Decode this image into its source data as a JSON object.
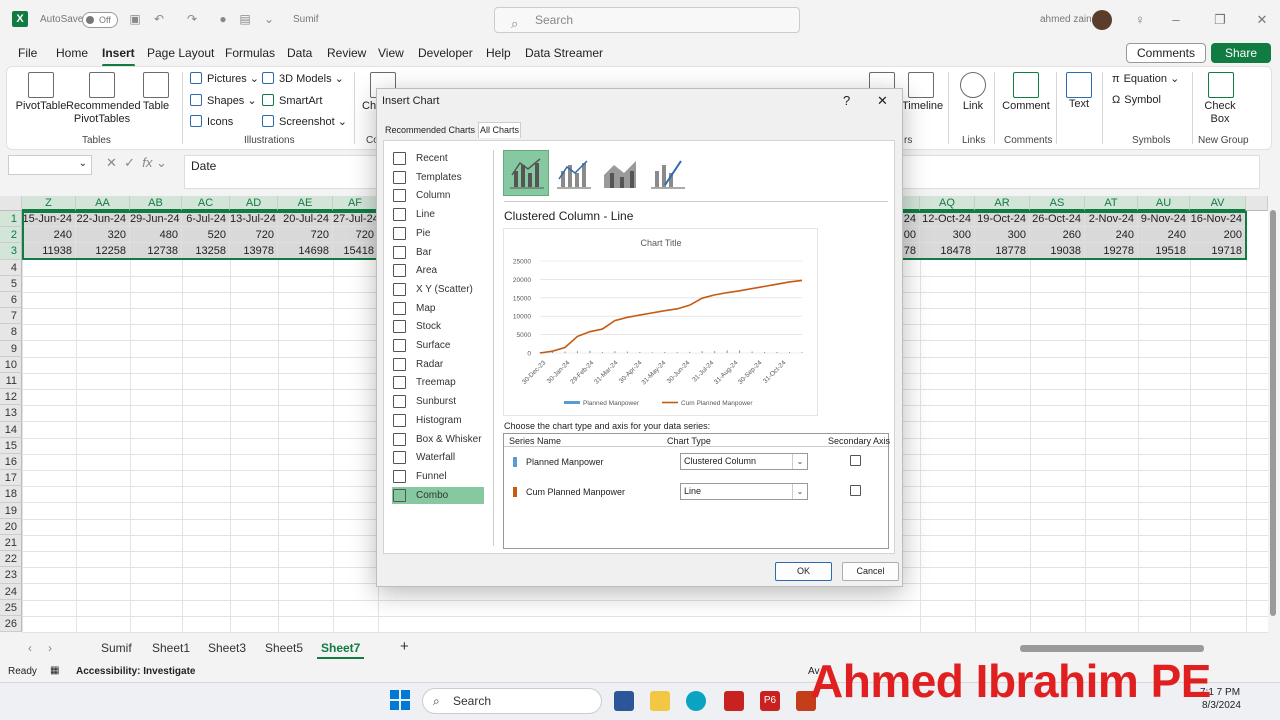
{
  "titlebar": {
    "autosave_label": "AutoSave",
    "autosave_state": "Off",
    "filename": "Sumif",
    "search_placeholder": "Search",
    "user_name": "ahmed zain"
  },
  "menu": [
    "File",
    "Home",
    "Insert",
    "Page Layout",
    "Formulas",
    "Data",
    "Review",
    "View",
    "Developer",
    "Help",
    "Data Streamer"
  ],
  "menu_active": "Insert",
  "buttons": {
    "comments": "Comments",
    "share": "Share"
  },
  "ribbon": {
    "pivottable": "PivotTable",
    "recommended_pivot": "Recommended PivotTables",
    "table": "Table",
    "tables_group": "Tables",
    "pictures": "Pictures",
    "shapes": "Shapes",
    "icons": "Icons",
    "models3d": "3D Models",
    "smartart": "SmartArt",
    "screenshot": "Screenshot",
    "illustrations_group": "Illustrations",
    "charts_partial": "Che",
    "charts_group_partial": "Co",
    "timeline": "Timeline",
    "filters_group_partial": "rs",
    "link": "Link",
    "links_group": "Links",
    "comment": "Comment",
    "comments_group": "Comments",
    "text": "Text",
    "equation": "Equation",
    "symbol": "Symbol",
    "symbols_group": "Symbols",
    "checkbox": "Check Box",
    "newgroup": "New Group"
  },
  "formula_bar": {
    "fx": "fx",
    "value": "Date"
  },
  "grid": {
    "left_cols": [
      "Z",
      "AA",
      "AB",
      "AC",
      "AD",
      "AE",
      "AF"
    ],
    "right_cols": [
      "AQ",
      "AR",
      "AS",
      "AT",
      "AU",
      "AV"
    ],
    "row_numbers": [
      "1",
      "2",
      "3",
      "4",
      "5",
      "6",
      "7",
      "8",
      "9",
      "10",
      "11",
      "12",
      "13",
      "14",
      "15",
      "16",
      "17",
      "18",
      "19",
      "20",
      "21",
      "22",
      "23",
      "24",
      "25",
      "26"
    ],
    "left_rows": [
      [
        "15-Jun-24",
        "22-Jun-24",
        "29-Jun-24",
        "6-Jul-24",
        "13-Jul-24",
        "20-Jul-24",
        "27-Jul-24"
      ],
      [
        "240",
        "320",
        "480",
        "520",
        "720",
        "720",
        "720"
      ],
      [
        "11938",
        "12258",
        "12738",
        "13258",
        "13978",
        "14698",
        "15418"
      ]
    ],
    "right_partial": [
      "24",
      "00",
      "78"
    ],
    "right_rows": [
      [
        "12-Oct-24",
        "19-Oct-24",
        "26-Oct-24",
        "2-Nov-24",
        "9-Nov-24",
        "16-Nov-24"
      ],
      [
        "300",
        "300",
        "260",
        "240",
        "240",
        "200"
      ],
      [
        "18478",
        "18778",
        "19038",
        "19278",
        "19518",
        "19718"
      ]
    ]
  },
  "sheet_tabs": [
    "Sumif",
    "Sheet1",
    "Sheet3",
    "Sheet5",
    "Sheet7"
  ],
  "sheet_active": "Sheet7",
  "status": {
    "ready": "Ready",
    "accessibility": "Accessibility: Investigate",
    "partial": "Av",
    "time": "7:1  7 PM",
    "date": "8/3/2024"
  },
  "taskbar": {
    "search": "Search"
  },
  "watermark": "Ahmed Ibrahim PE",
  "dialog": {
    "title": "Insert Chart",
    "help": "?",
    "close": "✕",
    "tabs": [
      "Recommended Charts",
      "All Charts"
    ],
    "chart_types": [
      "Recent",
      "Templates",
      "Column",
      "Line",
      "Pie",
      "Bar",
      "Area",
      "X Y (Scatter)",
      "Map",
      "Stock",
      "Surface",
      "Radar",
      "Treemap",
      "Sunburst",
      "Histogram",
      "Box & Whisker",
      "Waterfall",
      "Funnel",
      "Combo"
    ],
    "active_type": "Combo",
    "subtype_title": "Clustered Column - Line",
    "series_prompt": "Choose the chart type and axis for your data series:",
    "table_headers": {
      "name": "Series Name",
      "type": "Chart Type",
      "axis": "Secondary Axis"
    },
    "series": [
      {
        "name": "Planned Manpower",
        "chart_type": "Clustered Column",
        "color": "#5b9bd5"
      },
      {
        "name": "Cum Planned Manpower",
        "chart_type": "Line",
        "color": "#c55a11"
      }
    ],
    "ok": "OK",
    "cancel": "Cancel"
  },
  "chart_data": {
    "type": "line",
    "title": "Chart Title",
    "yticks": [
      "25000",
      "20000",
      "15000",
      "10000",
      "5000",
      "0"
    ],
    "ylim": [
      0,
      25000
    ],
    "xticks": [
      "30-Dec-23",
      "30-Jan-24",
      "29-Feb-24",
      "31-Mar-24",
      "30-Apr-24",
      "31-May-24",
      "30-Jun-24",
      "31-Jul-24",
      "31-Aug-24",
      "30-Sep-24",
      "31-Oct-24"
    ],
    "legend": [
      "Planned Manpower",
      "Cum Planned Manpower"
    ],
    "series": [
      {
        "name": "Cum Planned Manpower",
        "color": "#c55a11",
        "x": [
          "30-Dec-23",
          "15-Jan-24",
          "30-Jan-24",
          "15-Feb-24",
          "29-Feb-24",
          "15-Mar-24",
          "31-Mar-24",
          "15-Apr-24",
          "30-Apr-24",
          "15-May-24",
          "31-May-24",
          "15-Jun-24",
          "30-Jun-24",
          "15-Jul-24",
          "31-Jul-24",
          "15-Aug-24",
          "31-Aug-24",
          "15-Sep-24",
          "30-Sep-24",
          "15-Oct-24",
          "31-Oct-24",
          "16-Nov-24"
        ],
        "values": [
          0,
          500,
          1500,
          4500,
          5800,
          6500,
          8800,
          9700,
          10300,
          10900,
          11500,
          12000,
          13000,
          14900,
          15800,
          16400,
          16900,
          17500,
          18100,
          18700,
          19300,
          19718
        ]
      },
      {
        "name": "Planned Manpower",
        "color": "#5b9bd5",
        "values": [
          200,
          300,
          400,
          500,
          600,
          300,
          500,
          400,
          300,
          200,
          300,
          240,
          320,
          480,
          520,
          720,
          720,
          400,
          300,
          300,
          260,
          200
        ]
      }
    ]
  }
}
